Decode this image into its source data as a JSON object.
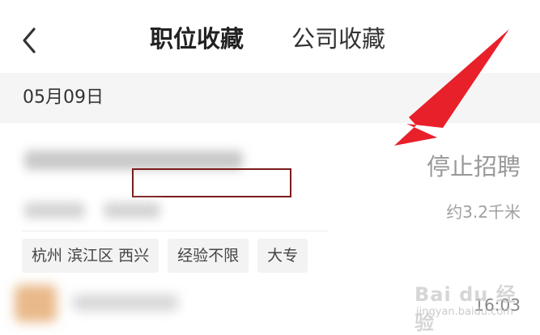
{
  "header": {
    "back_icon": "chevron-left-icon",
    "tabs": [
      {
        "label": "职位收藏",
        "active": true
      },
      {
        "label": "公司收藏",
        "active": false
      }
    ]
  },
  "date_section": {
    "date": "05月09日"
  },
  "job_card": {
    "status": "停止招聘",
    "distance": "约3.2千米",
    "tags": [
      "杭州 滨江区 西兴",
      "经验不限",
      "大专"
    ]
  },
  "next_card": {
    "time": "16:03"
  },
  "watermark": {
    "logo": "Bai du 经验",
    "url": "jingyan.baidu.com"
  },
  "colors": {
    "arrow": "#e8202a",
    "redact_box": "#7a1c1c",
    "date_bar_bg": "#f5f5f5"
  }
}
